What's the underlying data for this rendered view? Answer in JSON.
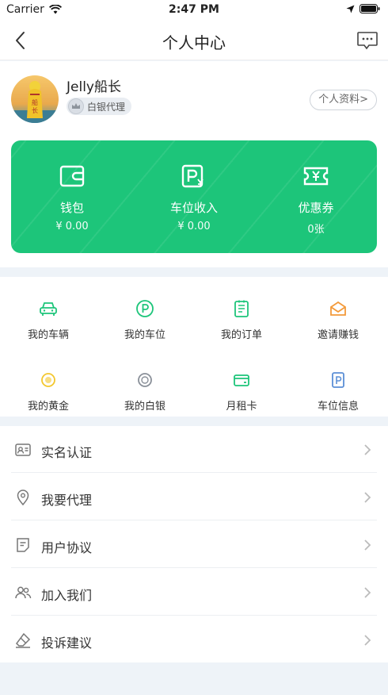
{
  "status_bar": {
    "carrier": "Carrier",
    "time": "2:47 PM"
  },
  "nav": {
    "title": "个人中心",
    "back_icon": "chevron-left-icon",
    "message_icon": "chat-bubble-icon"
  },
  "profile": {
    "username": "Jelly船长",
    "level": "白银代理",
    "profile_button": "个人资料>"
  },
  "wallet": {
    "items": [
      {
        "label": "钱包",
        "value": "¥ 0.00",
        "icon": "wallet-icon"
      },
      {
        "label": "车位收入",
        "value": "¥ 0.00",
        "icon": "parking-income-icon"
      },
      {
        "label": "优惠券",
        "value": "0张",
        "icon": "coupon-icon"
      }
    ],
    "accent": "#1dc57a"
  },
  "features": [
    {
      "label": "我的车辆",
      "icon": "car-icon",
      "color": "#1dc57a"
    },
    {
      "label": "我的车位",
      "icon": "parking-icon",
      "color": "#1dc57a"
    },
    {
      "label": "我的订单",
      "icon": "order-icon",
      "color": "#1dc57a"
    },
    {
      "label": "邀请赚钱",
      "icon": "envelope-icon",
      "color": "#f39a3a"
    },
    {
      "label": "我的黄金",
      "icon": "gold-medal-icon",
      "color": "#f3c72e"
    },
    {
      "label": "我的白银",
      "icon": "silver-medal-icon",
      "color": "#8a9099"
    },
    {
      "label": "月租卡",
      "icon": "card-icon",
      "color": "#1dc57a"
    },
    {
      "label": "车位信息",
      "icon": "parking-info-icon",
      "color": "#5b8fd6"
    }
  ],
  "menu": [
    {
      "label": "实名认证",
      "icon": "id-card-icon"
    },
    {
      "label": "我要代理",
      "icon": "location-pin-icon"
    },
    {
      "label": "用户协议",
      "icon": "document-icon"
    },
    {
      "label": "加入我们",
      "icon": "users-icon"
    },
    {
      "label": "投诉建议",
      "icon": "eraser-icon"
    }
  ]
}
